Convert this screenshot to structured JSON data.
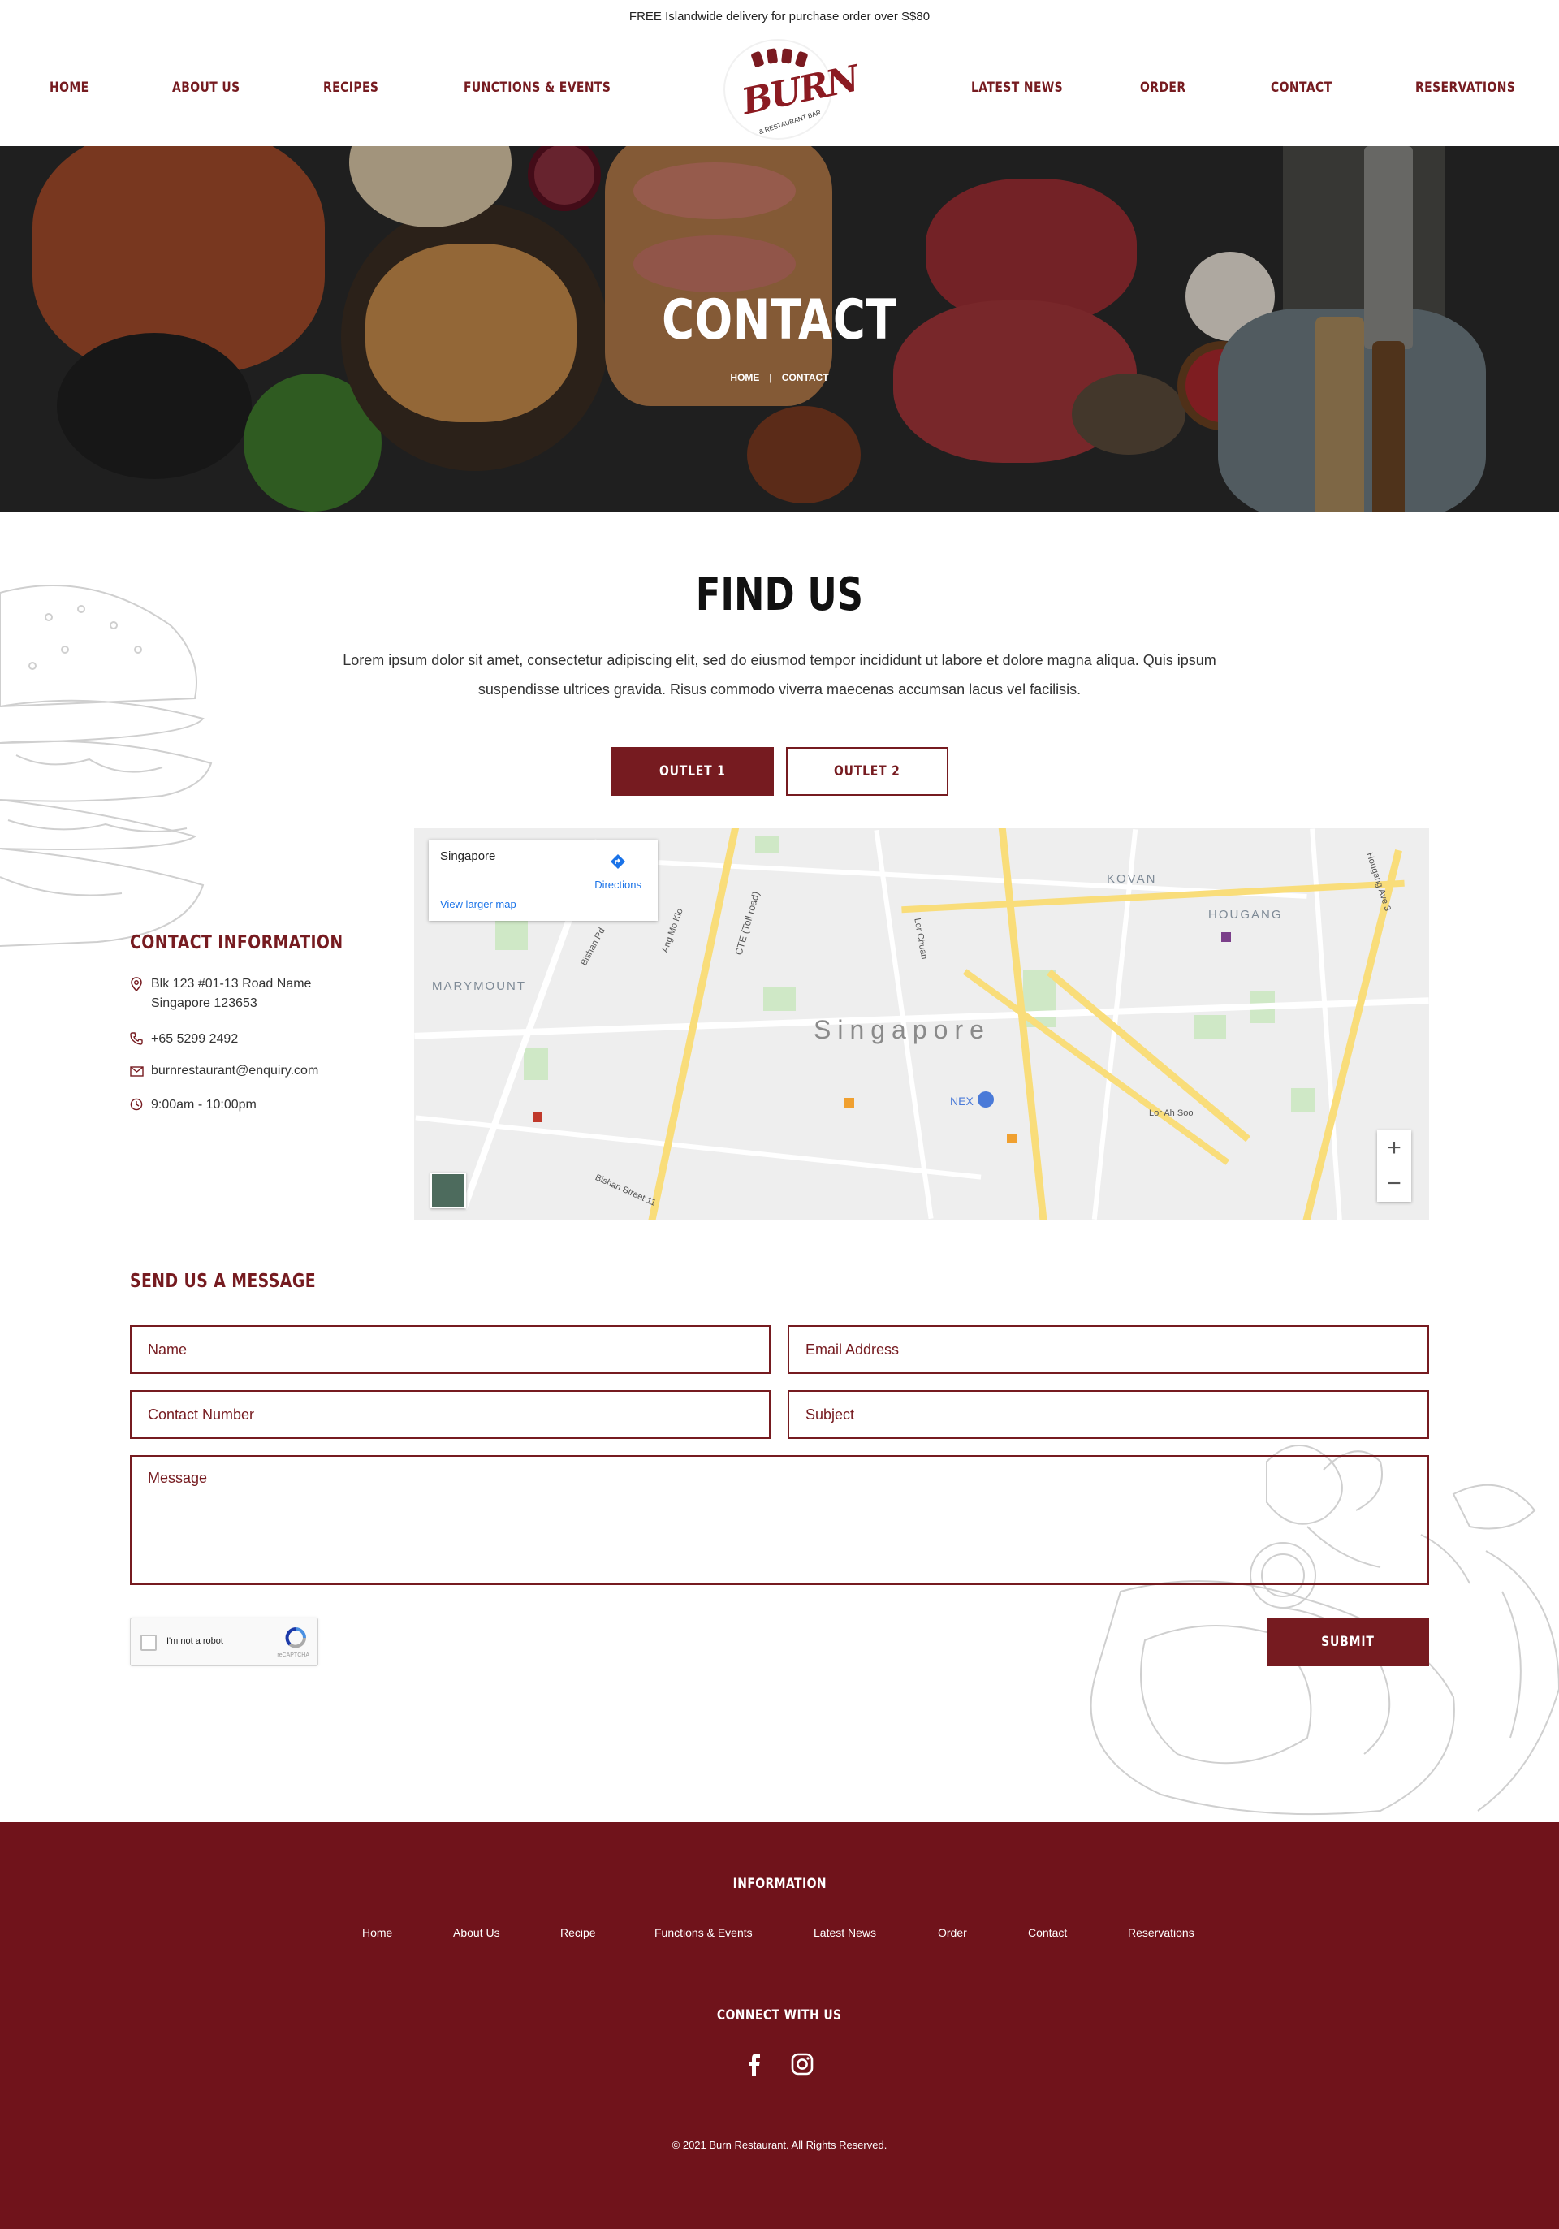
{
  "announcement": "FREE Islandwide delivery for purchase order over S$80",
  "nav": {
    "left": [
      "HOME",
      "ABOUT US",
      "RECIPES",
      "FUNCTIONS & EVENTS"
    ],
    "right": [
      "LATEST NEWS",
      "ORDER",
      "CONTACT",
      "RESERVATIONS"
    ]
  },
  "logo": {
    "word": "BURN",
    "tagline": "& RESTAURANT BAR"
  },
  "hero": {
    "title": "CONTACT",
    "breadcrumb": {
      "home": "HOME",
      "separator": "|",
      "current": "CONTACT"
    }
  },
  "find_us": {
    "title": "FIND US",
    "text": "Lorem ipsum dolor sit amet, consectetur adipiscing elit, sed do eiusmod tempor incididunt ut labore et dolore magna aliqua. Quis ipsum suspendisse ultrices gravida. Risus commodo viverra maecenas accumsan lacus vel facilisis.",
    "outlets": [
      "OUTLET 1",
      "OUTLET 2"
    ],
    "active_outlet": "OUTLET 1"
  },
  "contact_info": {
    "title": "CONTACT INFORMATION",
    "address_line1": "Blk 123 #01-13 Road Name",
    "address_line2": "Singapore 123653",
    "phone": "+65 5299 2492",
    "email": "burnrestaurant@enquiry.com",
    "hours": "9:00am - 10:00pm"
  },
  "map": {
    "place": "Singapore",
    "directions": "Directions",
    "larger_map": "View larger map",
    "center_label": "Singapore",
    "labels": {
      "kovan": "KOVAN",
      "hougang": "HOUGANG",
      "marymount": "MARYMOUNT",
      "nex": "NEX",
      "cte": "CTE (Toll road)",
      "lor_chuan": "Lor Chuan",
      "bishan_rd": "Bishan Rd",
      "ang_mo_kio": "Ang Mo Kio",
      "hougang_ave3": "Hougang Ave 3",
      "lor_ah_soo": "Lor Ah Soo",
      "bishan_st11": "Bishan Street 11"
    },
    "zoom_in": "+",
    "zoom_out": "−"
  },
  "form": {
    "title": "SEND US A MESSAGE",
    "name_placeholder": "Name",
    "email_placeholder": "Email Address",
    "contact_placeholder": "Contact Number",
    "subject_placeholder": "Subject",
    "message_placeholder": "Message",
    "captcha_label": "I'm not a robot",
    "captcha_brand": "reCAPTCHA",
    "submit": "SUBMIT"
  },
  "footer": {
    "information_title": "INFORMATION",
    "links": [
      "Home",
      "About Us",
      "Recipe",
      "Functions & Events",
      "Latest News",
      "Order",
      "Contact",
      "Reservations"
    ],
    "connect_title": "CONNECT WITH US",
    "copyright": "© 2021 Burn Restaurant. All Rights Reserved."
  },
  "colors": {
    "brand": "#761b20",
    "footer_bg": "#70131b",
    "map_yellow": "#f9dd7a"
  },
  "icons": [
    "map-pin-icon",
    "phone-icon",
    "mail-icon",
    "clock-icon",
    "facebook-icon",
    "instagram-icon",
    "directions-icon",
    "recaptcha-icon"
  ]
}
